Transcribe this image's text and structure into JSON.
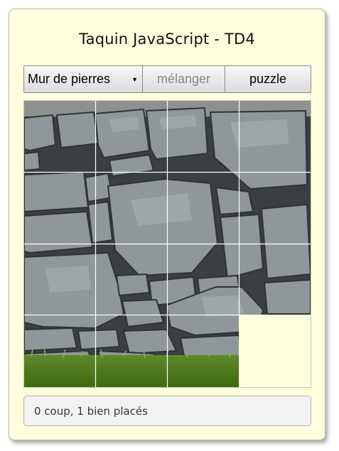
{
  "app": {
    "title": "Taquin JavaScript - TD4"
  },
  "controls": {
    "image_select": {
      "selected": "Mur de pierres",
      "options": [
        "Mur de pierres"
      ]
    },
    "shuffle_label": "mélanger",
    "shuffle_enabled": false,
    "puzzle_label": "puzzle"
  },
  "board": {
    "image": "Mur de pierres",
    "rows": 4,
    "cols": 4,
    "empty_cell": {
      "row": 4,
      "col": 4
    },
    "tile_grid_color": "#ffffff",
    "empty_color": "#ffffdd"
  },
  "status": {
    "text": "0 coup, 1 bien placés"
  },
  "colors": {
    "background": "#ffffdd",
    "status_background": "#f2f2f2",
    "status_text": "#333a3f"
  }
}
